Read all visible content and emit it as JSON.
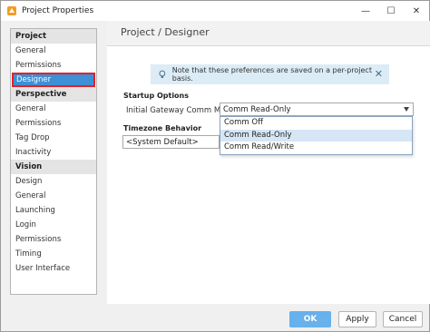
{
  "window": {
    "title": "Project Properties",
    "controls": {
      "minimize": "—",
      "maximize": "☐",
      "close": "✕"
    }
  },
  "sidebar": {
    "groups": [
      {
        "header": "Project",
        "items": [
          "General",
          "Permissions",
          "Designer"
        ]
      },
      {
        "header": "Perspective",
        "items": [
          "General",
          "Permissions",
          "Tag Drop",
          "Inactivity"
        ]
      },
      {
        "header": "Vision",
        "items": [
          "Design",
          "General",
          "Launching",
          "Login",
          "Permissions",
          "Timing",
          "User Interface"
        ]
      }
    ],
    "selected": "Designer"
  },
  "main": {
    "title": "Project / Designer",
    "notice": {
      "text": "Note that these preferences are saved on a per-project basis.",
      "close": "✕"
    },
    "startup": {
      "section_title": "Startup Options",
      "comm_label": "Initial Gateway Comm Mode",
      "comm_value": "Comm Read-Only",
      "options": [
        "Comm Off",
        "Comm Read-Only",
        "Comm Read/Write"
      ],
      "highlighted": "Comm Read-Only"
    },
    "timezone": {
      "section_title": "Timezone Behavior",
      "value": "<System Default>"
    }
  },
  "footer": {
    "ok": "OK",
    "apply": "Apply",
    "cancel": "Cancel"
  },
  "colors": {
    "selected_bg": "#3d8fd6",
    "selection_outline": "#e0232b",
    "primary_button": "#67b1ec",
    "notice_bg": "#dcecf6"
  }
}
